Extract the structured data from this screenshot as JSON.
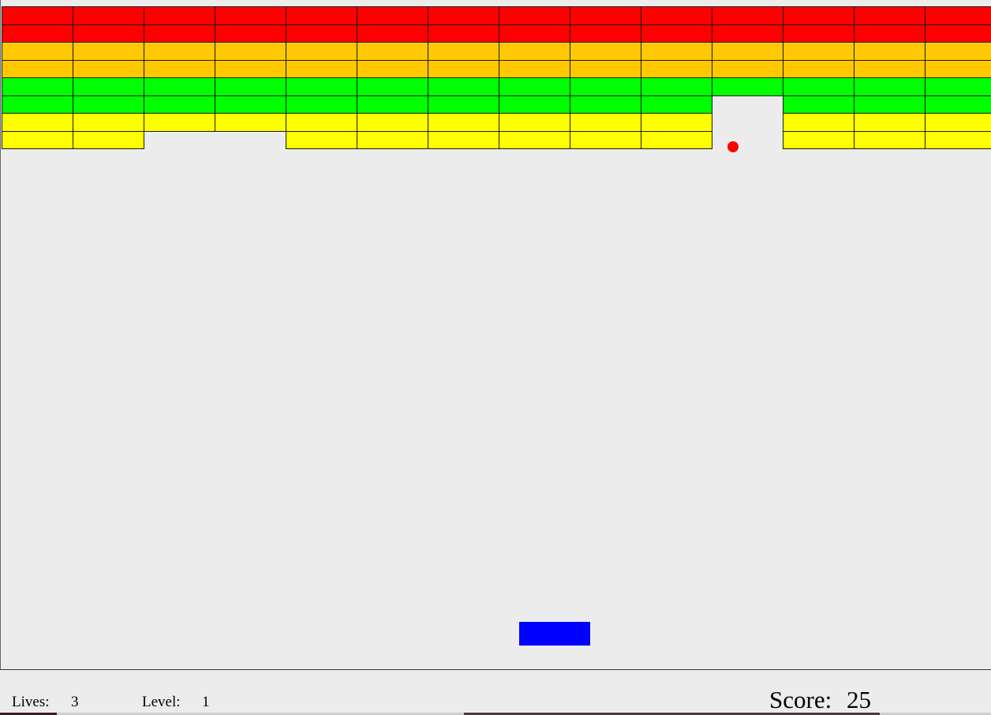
{
  "hud": {
    "lives_label": "Lives:",
    "lives_value": "3",
    "level_label": "Level:",
    "level_value": "1",
    "score_label": "Score:",
    "score_value": "25"
  },
  "colors": {
    "background": "#ececec",
    "ball": "#ff0000",
    "paddle": "#0000ff",
    "brick_red": "#ff0000",
    "brick_orange": "#ffc800",
    "brick_green": "#00ff00",
    "brick_yellow": "#ffff00"
  },
  "bricks": {
    "rows": 8,
    "columns": 14,
    "row_colors": [
      "brick_red",
      "brick_red",
      "brick_orange",
      "brick_orange",
      "brick_green",
      "brick_green",
      "brick_yellow",
      "brick_yellow"
    ],
    "destroyed": [
      [
        5,
        10
      ],
      [
        6,
        10
      ],
      [
        7,
        10
      ],
      [
        7,
        2
      ],
      [
        7,
        3
      ]
    ]
  }
}
